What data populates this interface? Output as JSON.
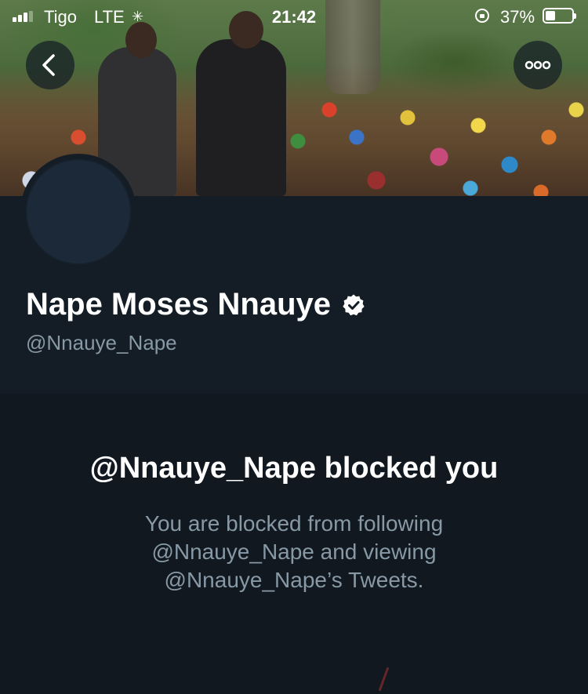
{
  "status_bar": {
    "carrier": "Tigo",
    "network": "LTE",
    "time": "21:42",
    "battery_percent_label": "37%",
    "battery_level": 0.37,
    "signal_bars": 3
  },
  "header": {
    "back_icon": "chevron-left-icon",
    "more_icon": "more-horizontal-icon"
  },
  "profile": {
    "display_name": "Nape Moses Nnauye",
    "handle": "@Nnauye_Nape",
    "verified": true
  },
  "blocked": {
    "title": "@Nnauye_Nape blocked you",
    "description_line1": "You are blocked from following",
    "description_line2": "@Nnauye_Nape and viewing",
    "description_line3": "@Nnauye_Nape’s Tweets."
  },
  "colors": {
    "background": "#141d26",
    "blocked_background": "#111820",
    "secondary_text": "#8899a6",
    "primary_text": "#ffffff"
  }
}
